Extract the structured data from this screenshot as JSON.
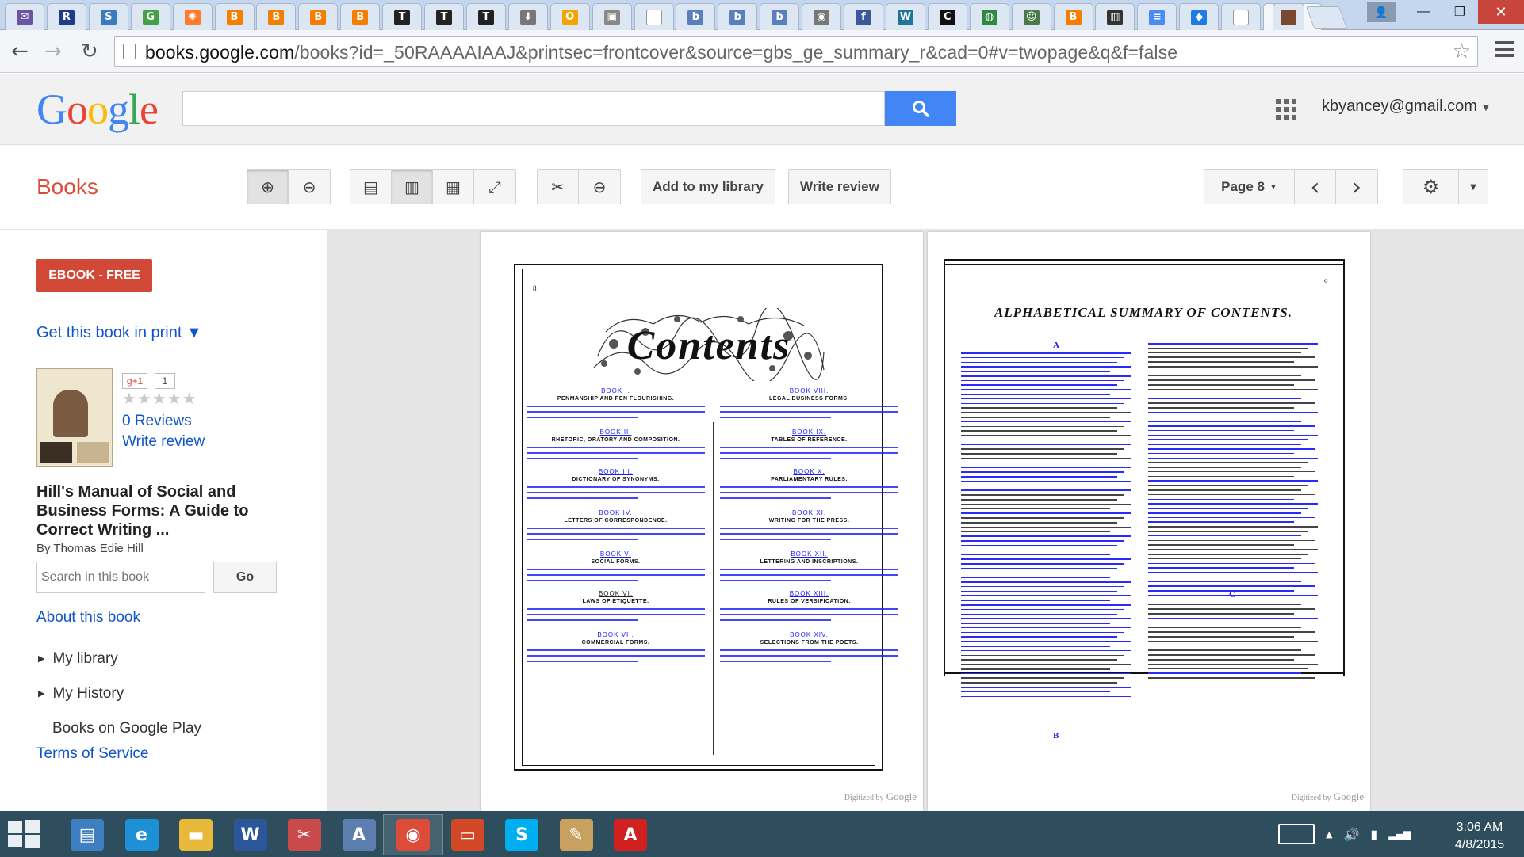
{
  "browser": {
    "tabs": [
      {
        "icon": "mail-icon",
        "glyph": "✉",
        "color": "#6a55a0"
      },
      {
        "icon": "letter-r-icon",
        "glyph": "R",
        "color": "#1f3c88"
      },
      {
        "icon": "swirl-icon",
        "glyph": "S",
        "color": "#3a7bbf"
      },
      {
        "icon": "green-badge-icon",
        "glyph": "G",
        "color": "#45a045"
      },
      {
        "icon": "sun-icon",
        "glyph": "✺",
        "color": "#ff7a2a"
      },
      {
        "icon": "blogger-icon",
        "glyph": "B",
        "color": "#f57d00"
      },
      {
        "icon": "blogger-icon",
        "glyph": "B",
        "color": "#f57d00"
      },
      {
        "icon": "blogger-icon",
        "glyph": "B",
        "color": "#f57d00"
      },
      {
        "icon": "blogger-icon",
        "glyph": "B",
        "color": "#f57d00"
      },
      {
        "icon": "nyt-icon",
        "glyph": "T",
        "color": "#222222"
      },
      {
        "icon": "nyt-icon",
        "glyph": "T",
        "color": "#222222"
      },
      {
        "icon": "nyt-icon",
        "glyph": "T",
        "color": "#222222"
      },
      {
        "icon": "download-icon",
        "glyph": "⬇",
        "color": "#777777"
      },
      {
        "icon": "coin-icon",
        "glyph": "O",
        "color": "#f0a500"
      },
      {
        "icon": "image-icon",
        "glyph": "▣",
        "color": "#888888"
      },
      {
        "icon": "blank-page-icon",
        "glyph": "",
        "color": "#ffffff"
      },
      {
        "icon": "letter-b-icon",
        "glyph": "b",
        "color": "#5a7fbf"
      },
      {
        "icon": "letter-b-icon",
        "glyph": "b",
        "color": "#5a7fbf"
      },
      {
        "icon": "letter-b-icon",
        "glyph": "b",
        "color": "#5a7fbf"
      },
      {
        "icon": "record-icon",
        "glyph": "◉",
        "color": "#777777"
      },
      {
        "icon": "facebook-icon",
        "glyph": "f",
        "color": "#3b5998"
      },
      {
        "icon": "wordpress-icon",
        "glyph": "W",
        "color": "#21759b"
      },
      {
        "icon": "letter-c-icon",
        "glyph": "C",
        "color": "#111111"
      },
      {
        "icon": "globe-icon",
        "glyph": "◍",
        "color": "#2d8a3e"
      },
      {
        "icon": "smiley-icon",
        "glyph": "☺",
        "color": "#4a7a4a"
      },
      {
        "icon": "blogger-icon",
        "glyph": "B",
        "color": "#f57d00"
      },
      {
        "icon": "library-icon",
        "glyph": "▥",
        "color": "#333333"
      },
      {
        "icon": "docs-icon",
        "glyph": "≡",
        "color": "#4a8af4"
      },
      {
        "icon": "dropbox-icon",
        "glyph": "◆",
        "color": "#1f7ce0"
      },
      {
        "icon": "blank-page-icon",
        "glyph": "",
        "color": "#ffffff"
      }
    ],
    "active_tab_close": "×",
    "window_buttons": {
      "user": "👤",
      "minimize": "—",
      "maximize": "❐",
      "close": "✕"
    },
    "url_host": "books.google.com",
    "url_rest": "/books?id=_50RAAAAIAAJ&printsec=frontcover&source=gbs_ge_summary_r&cad=0#v=twopage&q&f=false",
    "nav_back": "←",
    "nav_forward": "→",
    "nav_reload": "↻",
    "bookmark_star": "☆"
  },
  "google_header": {
    "logo_letters": [
      {
        "ch": "G",
        "color": "#4285f4"
      },
      {
        "ch": "o",
        "color": "#ea4335"
      },
      {
        "ch": "o",
        "color": "#fbbc05"
      },
      {
        "ch": "g",
        "color": "#4285f4"
      },
      {
        "ch": "l",
        "color": "#34a853"
      },
      {
        "ch": "e",
        "color": "#ea4335"
      }
    ],
    "search_value": "",
    "account": "kbyancey@gmail.com",
    "account_caret": "▼"
  },
  "toolbar": {
    "section_title": "Books",
    "add_library": "Add to my library",
    "write_review": "Write review",
    "page_label": "Page 8",
    "page_caret": "▼",
    "prev": "‹",
    "next": "›",
    "settings_caret": "▼",
    "zoom_in_glyph": "⊕",
    "zoom_out_glyph": "⊖",
    "single_page_glyph": "▤",
    "two_page_glyph": "▥",
    "thumbnail_glyph": "▦",
    "fullscreen_glyph": "⤢",
    "clip_glyph": "✂",
    "link_glyph": "⊖",
    "settings_glyph": "⚙"
  },
  "sidebar": {
    "ebook_button": "EBOOK - FREE",
    "get_in_print": "Get this book in print ▼",
    "gplus": "g+1",
    "gplus_count": "1",
    "stars": "★★★★★",
    "reviews": "0 Reviews",
    "write_review": "Write review",
    "book_title": "Hill's Manual of Social and Business Forms: A Guide to Correct Writing ...",
    "author": "By Thomas Edie Hill",
    "search_placeholder": "Search in this book",
    "go": "Go",
    "about": "About this book",
    "my_library": "My library",
    "my_history": "My History",
    "books_on_play": "Books on Google Play",
    "terms": "Terms of Service",
    "tri": "▶"
  },
  "viewer": {
    "left_page_number": "8",
    "right_page_number": "9",
    "contents_heading": "Contents",
    "summary_heading": "ALPHABETICAL SUMMARY OF CONTENTS.",
    "col_letters": [
      "A",
      "B",
      "C"
    ],
    "left_books": [
      {
        "head": "BOOK I.",
        "title": "PENMANSHIP AND PEN FLOURISHING."
      },
      {
        "head": "BOOK II.",
        "title": "RHETORIC, ORATORY AND COMPOSITION."
      },
      {
        "head": "BOOK III.",
        "title": "DICTIONARY OF SYNONYMS."
      },
      {
        "head": "BOOK IV.",
        "title": "LETTERS OF CORRESPONDENCE."
      },
      {
        "head": "BOOK V.",
        "title": "SOCIAL FORMS."
      },
      {
        "head": "BOOK VI.",
        "title": "LAWS OF ETIQUETTE."
      },
      {
        "head": "BOOK VII.",
        "title": "COMMERCIAL FORMS."
      }
    ],
    "right_books": [
      {
        "head": "BOOK VIII.",
        "title": "LEGAL BUSINESS FORMS."
      },
      {
        "head": "BOOK IX.",
        "title": "TABLES OF REFERENCE."
      },
      {
        "head": "BOOK X.",
        "title": "PARLIAMENTARY RULES."
      },
      {
        "head": "BOOK XI.",
        "title": "WRITING FOR THE PRESS."
      },
      {
        "head": "BOOK XII.",
        "title": "LETTERING AND INSCRIPTIONS."
      },
      {
        "head": "BOOK XIII.",
        "title": "RULES OF VERSIFICATION."
      },
      {
        "head": "BOOK XIV.",
        "title": "SELECTIONS FROM THE POETS."
      }
    ],
    "digitized_by": "Digitized by",
    "digitized_brand": "Google"
  },
  "taskbar": {
    "apps": [
      {
        "name": "server-manager-icon",
        "glyph": "▤",
        "color": "#3d7fc1",
        "active": false
      },
      {
        "name": "internet-explorer-icon",
        "glyph": "e",
        "color": "#1e90d6",
        "active": false
      },
      {
        "name": "file-explorer-icon",
        "glyph": "▬",
        "color": "#e8b83a",
        "active": false
      },
      {
        "name": "word-icon",
        "glyph": "W",
        "color": "#2b579a",
        "active": false
      },
      {
        "name": "snipping-tool-icon",
        "glyph": "✂",
        "color": "#c94a4a",
        "active": false
      },
      {
        "name": "address-book-icon",
        "glyph": "A",
        "color": "#5d7fb0",
        "active": false
      },
      {
        "name": "chrome-icon",
        "glyph": "◉",
        "color": "#dd4b39",
        "active": true
      },
      {
        "name": "presentation-icon",
        "glyph": "▭",
        "color": "#d24726",
        "active": false
      },
      {
        "name": "skype-icon",
        "glyph": "S",
        "color": "#00aff0",
        "active": false
      },
      {
        "name": "paint-icon",
        "glyph": "✎",
        "color": "#c8a060",
        "active": false
      },
      {
        "name": "acrobat-icon",
        "glyph": "A",
        "color": "#d02020",
        "active": false
      }
    ],
    "tray_up": "▲",
    "tray_volume": "🔊",
    "tray_battery": "▮",
    "tray_signal": "▂▄▆",
    "time": "3:06 AM",
    "date": "4/8/2015"
  }
}
